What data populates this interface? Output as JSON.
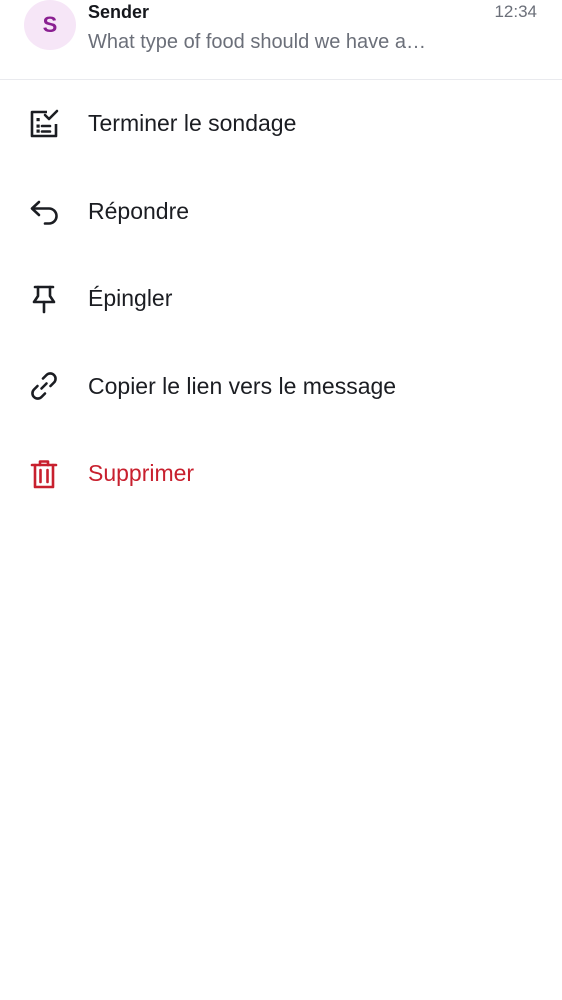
{
  "message": {
    "avatar_initial": "S",
    "sender": "Sender",
    "preview": "What type of food should we have a…",
    "time": "12:34"
  },
  "menu": {
    "items": [
      {
        "label": "Terminer le sondage",
        "icon": "poll-end-icon"
      },
      {
        "label": "Répondre",
        "icon": "reply-icon"
      },
      {
        "label": "Épingler",
        "icon": "pin-icon"
      },
      {
        "label": "Copier le lien vers le message",
        "icon": "link-icon"
      },
      {
        "label": "Supprimer",
        "icon": "trash-icon",
        "color": "#c8202e"
      }
    ]
  },
  "colors": {
    "avatar_bg": "#f6e6f7",
    "avatar_text": "#8a1f91",
    "danger": "#c8202e",
    "text": "#1b1d22",
    "muted": "#6b6f79"
  }
}
